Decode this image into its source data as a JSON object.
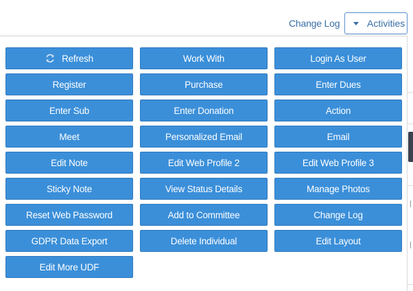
{
  "header": {
    "change_log_link": "Change Log",
    "activities_button": "Activities"
  },
  "menu": {
    "buttons": [
      "Refresh",
      "Work With",
      "Login As User",
      "Register",
      "Purchase",
      "Enter Dues",
      "Enter Sub",
      "Enter Donation",
      "Action",
      "Meet",
      "Personalized Email",
      "Email",
      "Edit Note",
      "Edit Web Profile 2",
      "Edit Web Profile 3",
      "Sticky Note",
      "View Status Details",
      "Manage Photos",
      "Reset Web Password",
      "Add to Committee",
      "Change Log",
      "GDPR Data Export",
      "Delete Individual",
      "Edit Layout",
      "Edit More UDF"
    ]
  },
  "colors": {
    "button_bg": "#3b8fd9",
    "button_text": "#ffffff",
    "link_text": "#3a6ea5"
  }
}
